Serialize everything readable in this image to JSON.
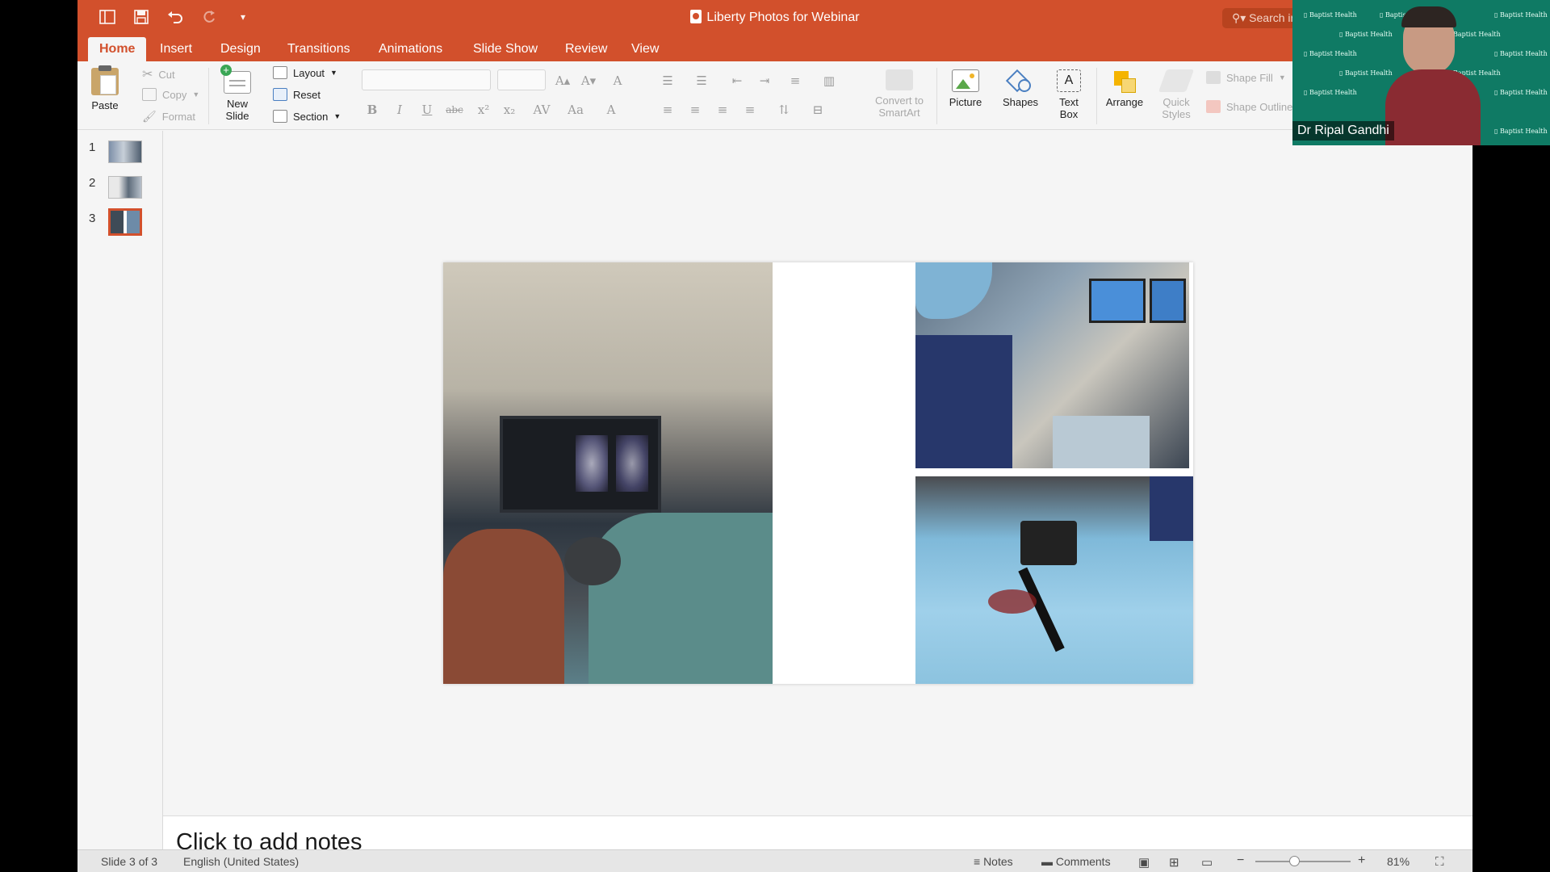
{
  "window": {
    "title": "Liberty Photos for Webinar",
    "search_placeholder": "Search in"
  },
  "tabs": [
    "Home",
    "Insert",
    "Design",
    "Transitions",
    "Animations",
    "Slide Show",
    "Review",
    "View"
  ],
  "ribbon": {
    "paste": "Paste",
    "cut": "Cut",
    "copy": "Copy",
    "format": "Format",
    "new_slide_line1": "New",
    "new_slide_line2": "Slide",
    "layout": "Layout",
    "reset": "Reset",
    "section": "Section",
    "convert_line1": "Convert to",
    "convert_line2": "SmartArt",
    "picture": "Picture",
    "shapes": "Shapes",
    "text_box_line1": "Text",
    "text_box_line2": "Box",
    "arrange": "Arrange",
    "quick_styles_line1": "Quick",
    "quick_styles_line2": "Styles",
    "shape_fill": "Shape Fill",
    "shape_outline": "Shape Outline"
  },
  "thumbnails": [
    {
      "number": "1",
      "selected": false
    },
    {
      "number": "2",
      "selected": false
    },
    {
      "number": "3",
      "selected": true
    }
  ],
  "notes_placeholder": "Click to add notes",
  "status": {
    "slide_info": "Slide 3 of 3",
    "language": "English (United States)",
    "notes": "Notes",
    "comments": "Comments",
    "zoom_minus": "−",
    "zoom_plus": "+",
    "zoom": "81%",
    "zoom_fraction": 0.4
  },
  "webcam": {
    "name": "Dr Ripal Gandhi",
    "background_text": "Baptist Health"
  },
  "colors": {
    "accent": "#d2502c",
    "webcam_bg": "#0f7a64"
  }
}
